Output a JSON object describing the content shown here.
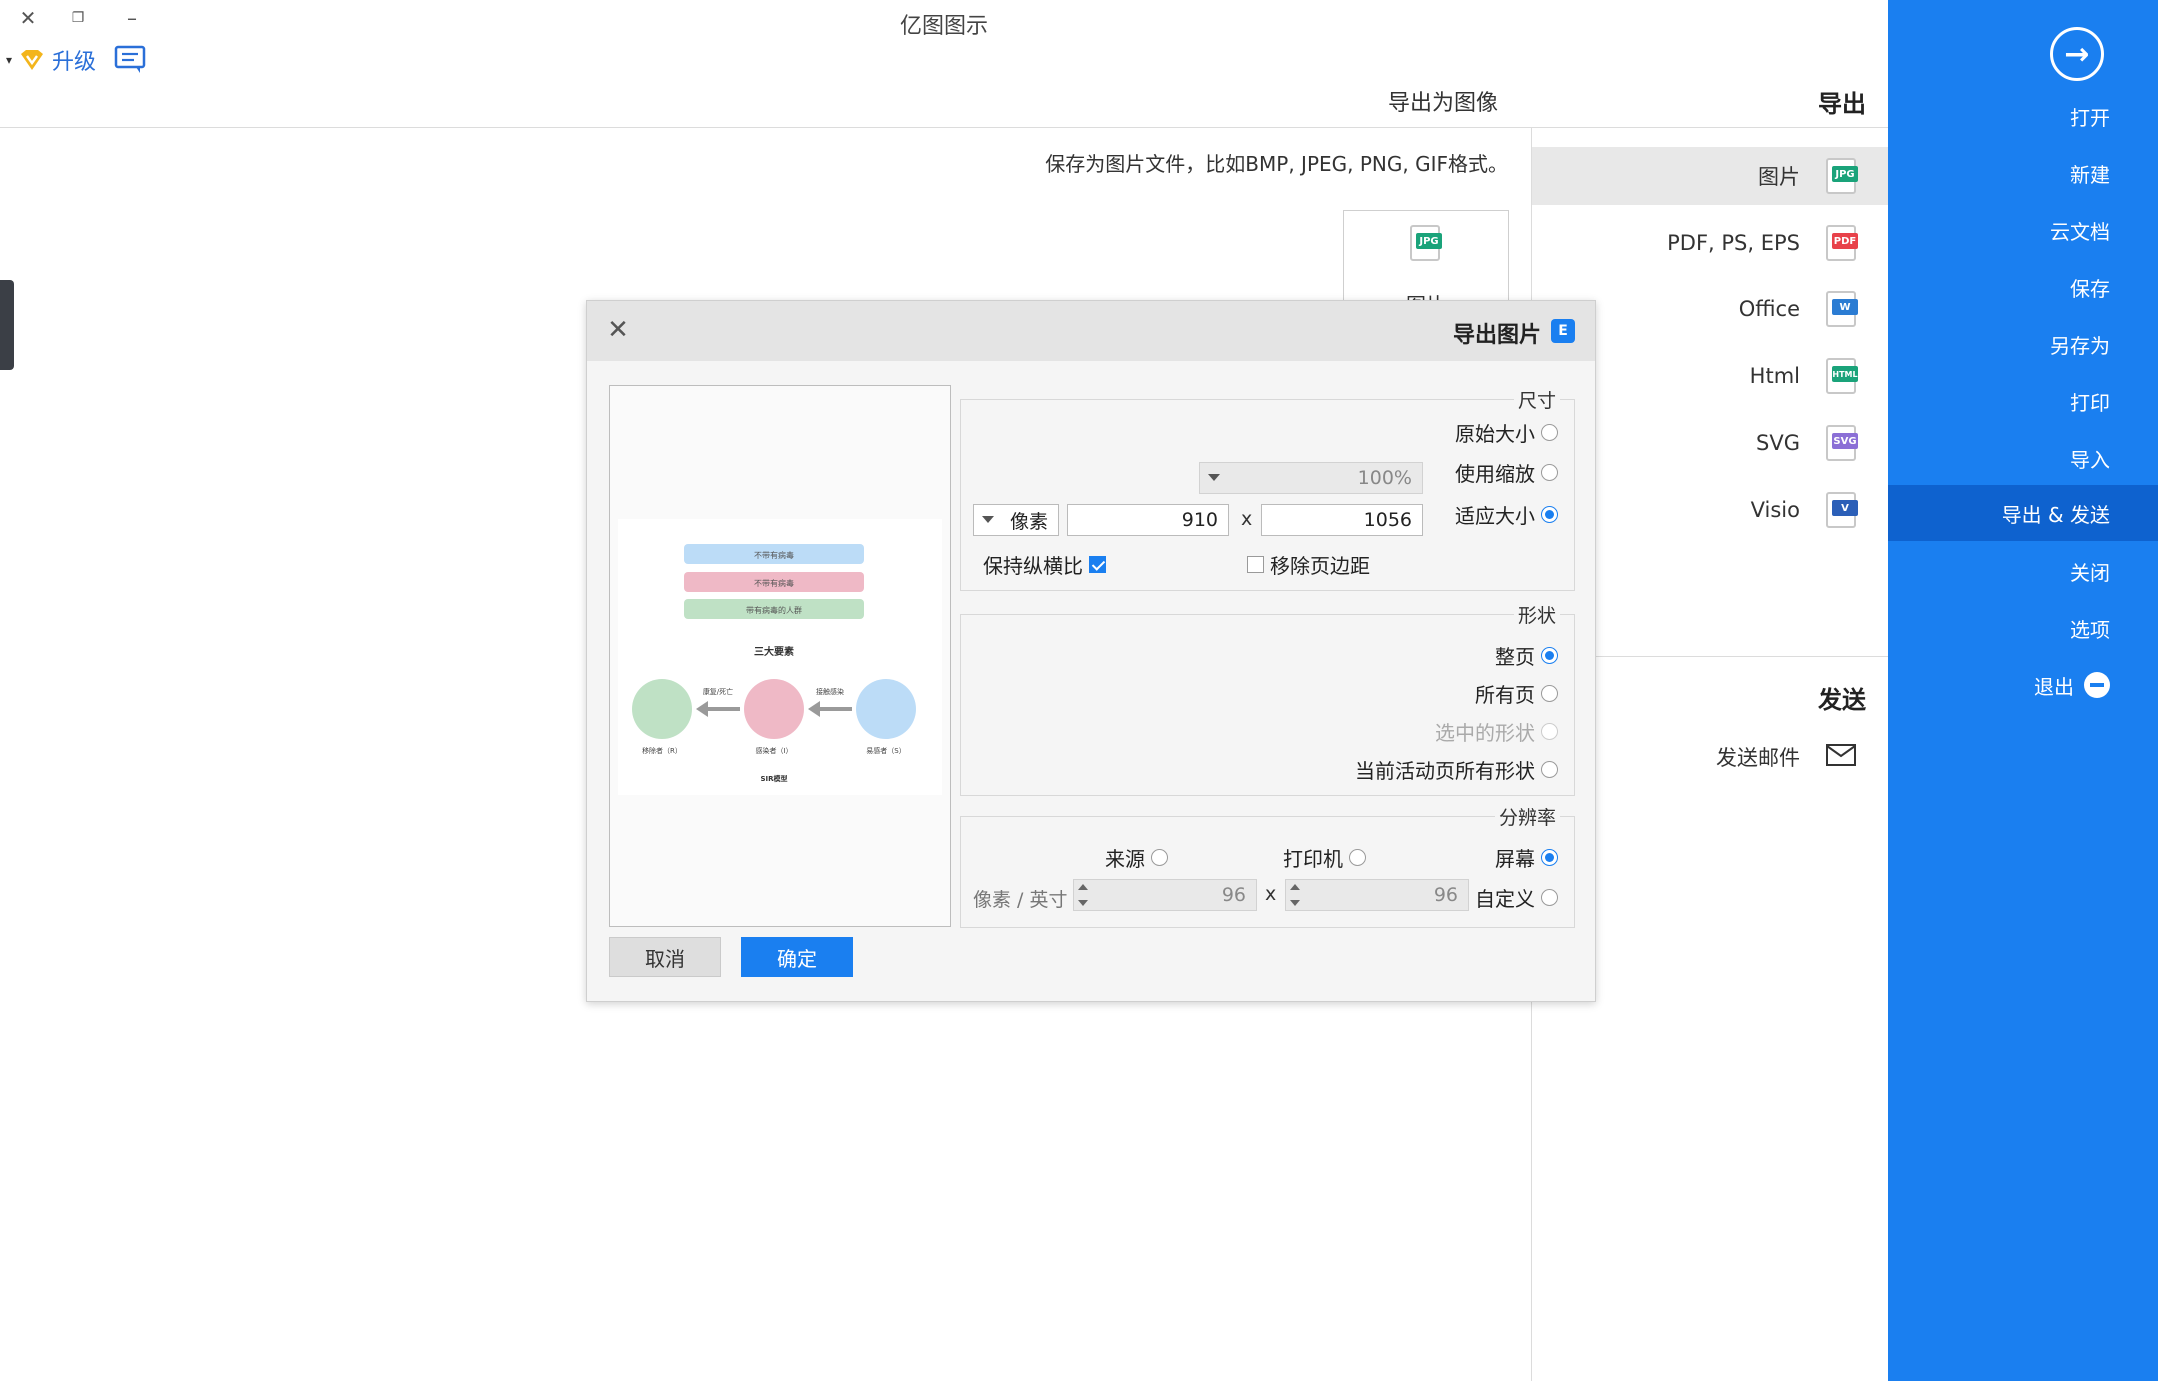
{
  "app": {
    "title": "亿图图示"
  },
  "window": {
    "close_glyph": "✕",
    "restore_glyph": "❐",
    "minimize_glyph": "–"
  },
  "toolbar": {
    "upgrade_label": "升级",
    "caret": "▾"
  },
  "page_header": {
    "title": "导出为图像"
  },
  "export_section": {
    "title": "导出",
    "items": [
      {
        "label": "图片",
        "tag": "JPG",
        "color": "#1aa37a"
      },
      {
        "label": "PDF, PS, EPS",
        "tag": "PDF",
        "color": "#e8424a"
      },
      {
        "label": "Office",
        "tag": "W",
        "color": "#2b7cd3"
      },
      {
        "label": "Html",
        "tag": "HTML",
        "color": "#1aa37a"
      },
      {
        "label": "SVG",
        "tag": "SVG",
        "color": "#8b6fd6"
      },
      {
        "label": "Visio",
        "tag": "V",
        "color": "#2b5fb8"
      }
    ]
  },
  "send_section": {
    "title": "发送",
    "email_label": "发送邮件"
  },
  "content": {
    "description": "保存为图片文件，比如BMP, JPEG, PNG, GIF格式。",
    "card_label": "图片",
    "card_tag": "JPG"
  },
  "sidebar": {
    "items": [
      "打开",
      "新建",
      "云文档",
      "保存",
      "另存为",
      "打印",
      "导入",
      "导出 & 发送",
      "关闭",
      "选项",
      "退出"
    ]
  },
  "dialog": {
    "title": "导出图片",
    "logo": "E",
    "size_group": {
      "label": "尺寸",
      "original": "原始大小",
      "use_scale": "使用缩放",
      "scale_value": "100%",
      "fit_size": "适应大小",
      "width": "1056",
      "height": "910",
      "unit": "像素",
      "times": "x",
      "keep_ratio": "保持纵横比",
      "remove_margin": "移除页边距"
    },
    "shape_group": {
      "label": "形状",
      "options": [
        "整页",
        "所有页",
        "选中的形状",
        "当前活动页所有形状"
      ]
    },
    "resolution_group": {
      "label": "分辨率",
      "screen": "屏幕",
      "printer": "打印机",
      "source": "来源",
      "custom": "自定义",
      "dpi_x": "96",
      "dpi_y": "96",
      "unit": "像素 / 英寸",
      "times": "x"
    },
    "ok_label": "确定",
    "cancel_label": "取消",
    "close_glyph": "✕"
  },
  "preview_diagram": {
    "title": "三大要素",
    "footer": "SIR模型",
    "bars": [
      "不带有病毒",
      "不带有病毒",
      "带有病毒的人群"
    ],
    "circles": [
      "易感者（S）",
      "感染者（I）",
      "移除者（R）"
    ],
    "arrows": [
      "接触感染",
      "康复/死亡"
    ],
    "colors": {
      "blue": "#bcdcf7",
      "pink": "#efb9c6",
      "green": "#bfe1c5"
    }
  }
}
